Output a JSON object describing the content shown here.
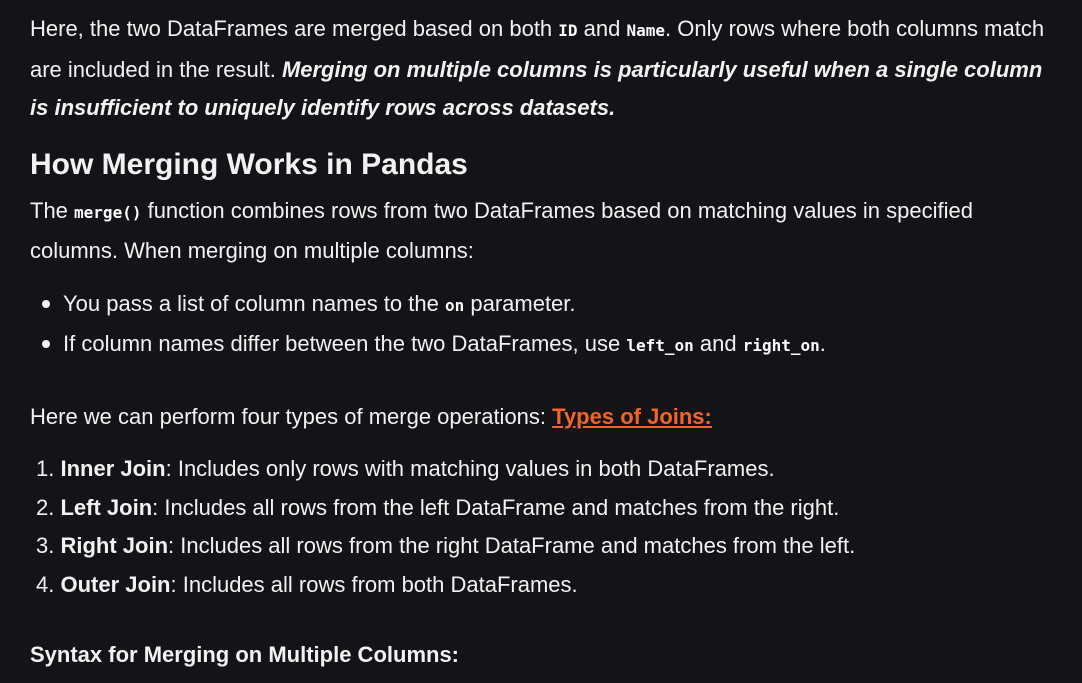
{
  "intro": {
    "t1": "Here, the two DataFrames are merged based on both ",
    "c1": "ID",
    "t2": " and ",
    "c2": "Name",
    "t3": ". Only rows where both columns match are included in the result. ",
    "emphasis": "Merging on multiple columns is particularly useful when a single column is insufficient to uniquely identify rows across datasets."
  },
  "heading": "How Merging Works in Pandas",
  "how": {
    "t1": "The ",
    "c1": "merge()",
    "t2": " function combines rows from two DataFrames based on matching values in specified columns. When merging on multiple columns:"
  },
  "bullets": [
    {
      "t1": "You pass a list of column names to the ",
      "c1": "on",
      "t2": " parameter."
    },
    {
      "t1": "If column names differ between the two DataFrames, use ",
      "c1": "left_on",
      "t2": " and ",
      "c2": "right_on",
      "t3": "."
    }
  ],
  "perform": {
    "text": "Here we can perform four types of merge operations: ",
    "link": "Types of Joins:"
  },
  "joins": [
    {
      "num": "1.",
      "name": "Inner Join",
      "desc": ": Includes only rows with matching values in both DataFrames."
    },
    {
      "num": "2.",
      "name": "Left Join",
      "desc": ": Includes all rows from the left DataFrame and matches from the right."
    },
    {
      "num": "3.",
      "name": "Right Join",
      "desc": ": Includes all rows from the right DataFrame and matches from the left."
    },
    {
      "num": "4.",
      "name": "Outer Join",
      "desc": ": Includes all rows from both DataFrames."
    }
  ],
  "syntax_heading": "Syntax for Merging on Multiple Columns:",
  "colors": {
    "background": "#131417",
    "text": "#f2f2f2",
    "link": "#f26522"
  }
}
